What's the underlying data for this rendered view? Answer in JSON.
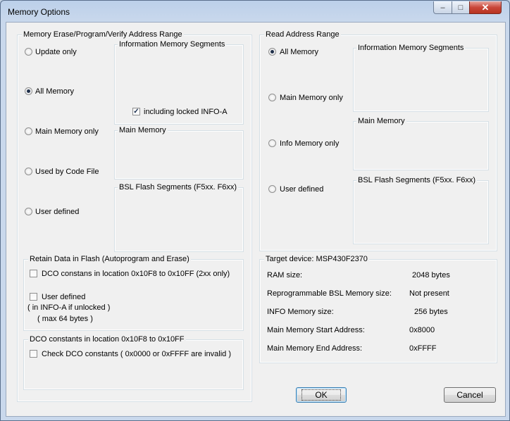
{
  "window": {
    "title": "Memory Options"
  },
  "erase": {
    "title": "Memory Erase/Program/Verify Address Range",
    "options": [
      "Update only",
      "All Memory",
      "Main Memory only",
      "Used by Code File",
      "User defined"
    ],
    "info_segments_title": "Information Memory Segments",
    "locked_info_label": "including locked INFO-A",
    "main_memory_title": "Main Memory",
    "bsl_title": "BSL Flash Segments (F5xx. F6xx)"
  },
  "read": {
    "title": "Read Address Range",
    "options": [
      "All Memory",
      "Main Memory only",
      "Info Memory only",
      "User defined"
    ],
    "info_segments_title": "Information Memory Segments",
    "main_memory_title": "Main Memory",
    "bsl_title": "BSL Flash Segments (F5xx. F6xx)"
  },
  "retain": {
    "title": "Retain Data in Flash (Autoprogram and Erase)",
    "dco_label": "DCO constans in location 0x10F8 to 0x10FF (2xx only)",
    "user_defined_label": "User defined",
    "note1": "( in INFO-A if unlocked )",
    "note2": "( max 64 bytes )"
  },
  "dco": {
    "title": "DCO constants in location 0x10F8 to 0x10FF",
    "check_label": "Check DCO constants ( 0x0000 or 0xFFFF are invalid )"
  },
  "target": {
    "title": "Target device:  MSP430F2370",
    "rows": [
      {
        "label": "RAM size:",
        "value": "2048  bytes"
      },
      {
        "label": "Reprogrammable BSL Memory size:",
        "value": "Not present"
      },
      {
        "label": "INFO Memory size:",
        "value": "256  bytes"
      },
      {
        "label": "Main Memory Start Address:",
        "value": "0x8000"
      },
      {
        "label": "Main Memory End Address:",
        "value": "0xFFFF"
      }
    ]
  },
  "buttons": {
    "ok": "OK",
    "cancel": "Cancel"
  },
  "state": {
    "erase_selected": 1,
    "read_selected": 0,
    "locked_info_checked": true
  }
}
